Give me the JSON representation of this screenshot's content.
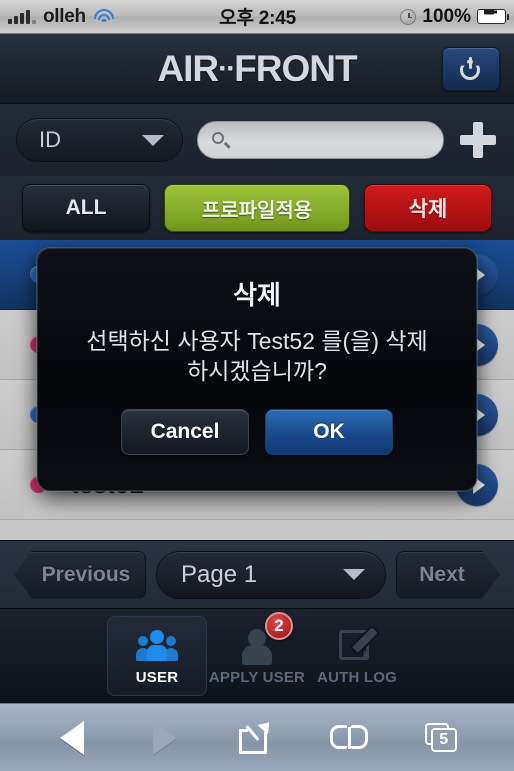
{
  "statusbar": {
    "carrier": "olleh",
    "signal_icon": "signal-bars-icon",
    "wifi_icon": "wifi-icon",
    "time": "오후 2:45",
    "alarm_icon": "alarm-clock-icon",
    "battery_percent": "100%",
    "battery_icon": "battery-charging-icon"
  },
  "header": {
    "logo_part1": "AIR",
    "logo_dots": "··",
    "logo_part2": "FRONT",
    "power_button_label": "power-button",
    "power_icon": "power-icon"
  },
  "search": {
    "filter_label": "ID",
    "chevron_icon": "chevron-down-icon",
    "search_icon": "search-icon",
    "search_value": "",
    "search_placeholder": "",
    "add_icon": "plus-icon"
  },
  "actions": {
    "all_label": "ALL",
    "profile_label": "프로파일적용",
    "delete_label": "삭제",
    "green_hex": "#8fb62f",
    "red_hex": "#c4161a"
  },
  "list": {
    "rows": [
      {
        "name": "",
        "dot_color": "#2f6fc4",
        "selected": true,
        "disclosure_icon": "disclosure-arrow-icon"
      },
      {
        "name": "",
        "dot_color": "#d6336c",
        "selected": false,
        "disclosure_icon": "disclosure-arrow-icon"
      },
      {
        "name": "",
        "dot_color": "#2f6fc4",
        "selected": false,
        "disclosure_icon": "disclosure-arrow-icon"
      },
      {
        "name": "test02",
        "dot_color": "#d6336c",
        "selected": false,
        "disclosure_icon": "disclosure-arrow-icon"
      }
    ]
  },
  "pager": {
    "previous_label": "Previous",
    "page_label": "Page 1",
    "next_label": "Next",
    "chevron_icon": "chevron-down-icon"
  },
  "tabbar": {
    "tabs": [
      {
        "label": "USER",
        "icon": "users-group-icon",
        "active": true,
        "badge": ""
      },
      {
        "label": "APPLY USER",
        "icon": "person-icon",
        "active": false,
        "badge": "2"
      },
      {
        "label": "AUTH LOG",
        "icon": "edit-square-pencil-icon",
        "active": false,
        "badge": ""
      }
    ],
    "badge_hex": "#b11a1c"
  },
  "dialog": {
    "title": "삭제",
    "message_line1": "선택하신 사용자 Test52 를(을) 삭제",
    "message_line2": "하시겠습니까?",
    "cancel_label": "Cancel",
    "ok_label": "OK"
  },
  "safaribar": {
    "back_icon": "back-arrow-icon",
    "forward_icon": "forward-arrow-icon",
    "share_icon": "share-icon",
    "bookmarks_icon": "bookmarks-book-icon",
    "tabs_icon": "tabs-icon",
    "tabs_count": "5"
  }
}
